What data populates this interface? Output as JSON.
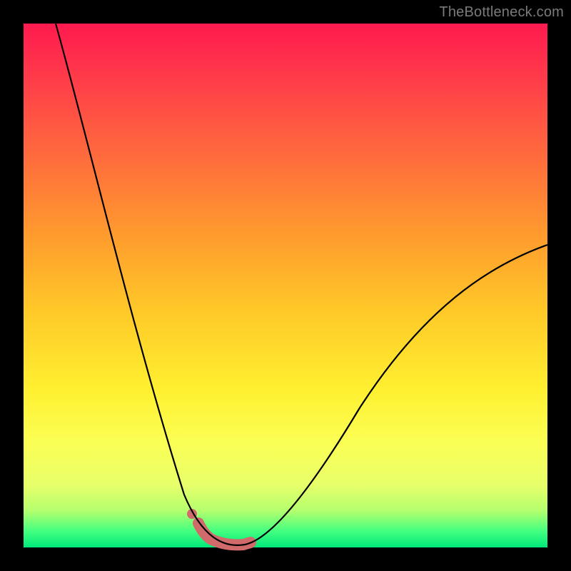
{
  "watermark": "TheBottleneck.com",
  "colors": {
    "curve": "#000000",
    "highlight": "#d16a6a",
    "frame": "#000000"
  },
  "chart_data": {
    "type": "line",
    "title": "",
    "xlabel": "",
    "ylabel": "",
    "xlim": [
      0,
      100
    ],
    "ylim": [
      0,
      100
    ],
    "grid": false,
    "legend": false,
    "annotations": [
      "TheBottleneck.com"
    ],
    "series": [
      {
        "name": "bottleneck-curve",
        "x": [
          6,
          8,
          10,
          12,
          14,
          16,
          18,
          20,
          22,
          24,
          26,
          28,
          30,
          32,
          33,
          34,
          36,
          38,
          40,
          44,
          48,
          52,
          56,
          60,
          64,
          68,
          72,
          76,
          80,
          84,
          88,
          92,
          96,
          100
        ],
        "y": [
          100,
          91,
          82,
          74,
          66,
          58,
          51,
          44,
          37,
          30,
          24,
          18,
          12,
          6,
          3,
          2,
          1,
          0.5,
          0.5,
          1,
          2,
          5,
          9,
          14,
          19,
          24,
          29,
          34,
          39,
          43,
          47,
          51,
          55,
          58
        ]
      },
      {
        "name": "optimal-range-highlight",
        "x": [
          33,
          34,
          36,
          38,
          40,
          42,
          44
        ],
        "y": [
          3,
          2,
          1,
          0.5,
          0.5,
          1,
          1.5
        ]
      }
    ],
    "marker": {
      "x": 31,
      "y": 8
    }
  }
}
